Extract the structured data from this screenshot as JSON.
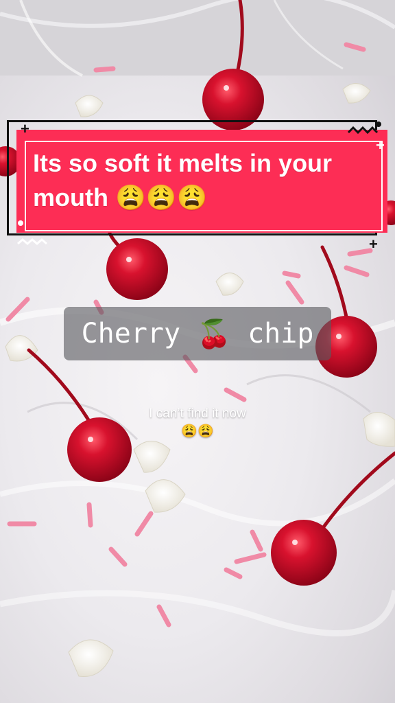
{
  "overlay": {
    "title": "Its so soft it melts in your mouth 😩😩😩",
    "label_left": "Cherry",
    "label_emoji": "🍒",
    "label_right": "chip",
    "caption_line1": "I can’t find it now",
    "caption_line2": "😩😩"
  },
  "colors": {
    "banner": "#fd2d55",
    "label_background": "#5a5a5f",
    "cherry": "#c8102e"
  }
}
